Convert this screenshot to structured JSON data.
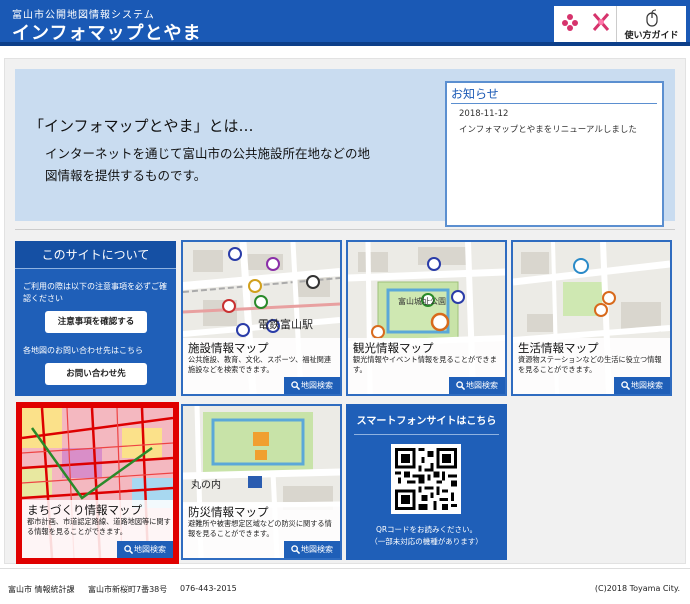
{
  "header": {
    "subtitle": "富山市公開地図情報システム",
    "title": "インフォマップとやま",
    "guide_label": "使い方ガイド",
    "accent_color": "#1a59b5"
  },
  "hero": {
    "heading": "「インフォマップとやま」とは…",
    "body": "インターネットを通じて富山市の公共施設所在地などの地図情報を提供するものです。"
  },
  "news": {
    "title": "お知らせ",
    "items": [
      {
        "date": "2018-11-12",
        "text": "インフォマップとやまをリニューアルしました"
      }
    ]
  },
  "about": {
    "title": "このサイトについて",
    "notice": "ご利用の際は以下の注意事項を必ずご確認ください",
    "notice_button": "注意事項を確認する",
    "contact_text": "各地図のお問い合わせ先はこちら",
    "contact_button": "お問い合わせ先"
  },
  "search_label": "地図検索",
  "cards": [
    {
      "title": "施設情報マップ",
      "desc": "公共施設、教育、文化、スポーツ、福祉関連施設などを検索できます。",
      "map_text": "電鉄富山駅"
    },
    {
      "title": "観光情報マップ",
      "desc": "観光情報やイベント情報を見ることができます。",
      "map_text": "富山城址公園"
    },
    {
      "title": "生活情報マップ",
      "desc": "資源物ステーションなどの生活に役立つ情報を見ることができます。"
    },
    {
      "title": "まちづくり情報マップ",
      "desc": "都市計画、市道認定路線、道路地図等に関する情報を見ることができます。"
    },
    {
      "title": "防災情報マップ",
      "desc": "避難所や被害想定区域などの防災に関する情報を見ることができます。",
      "map_text": "丸の内"
    }
  ],
  "smartphone": {
    "title": "スマートフォンサイトはこちら",
    "line1": "QRコードをお読みください。",
    "line2": "（一部未対応の機種があります）"
  },
  "footer": {
    "department": "富山市 情報統計課",
    "address": "富山市新桜町7番38号",
    "phone": "076-443-2015",
    "copyright": "(C)2018 Toyama City."
  }
}
